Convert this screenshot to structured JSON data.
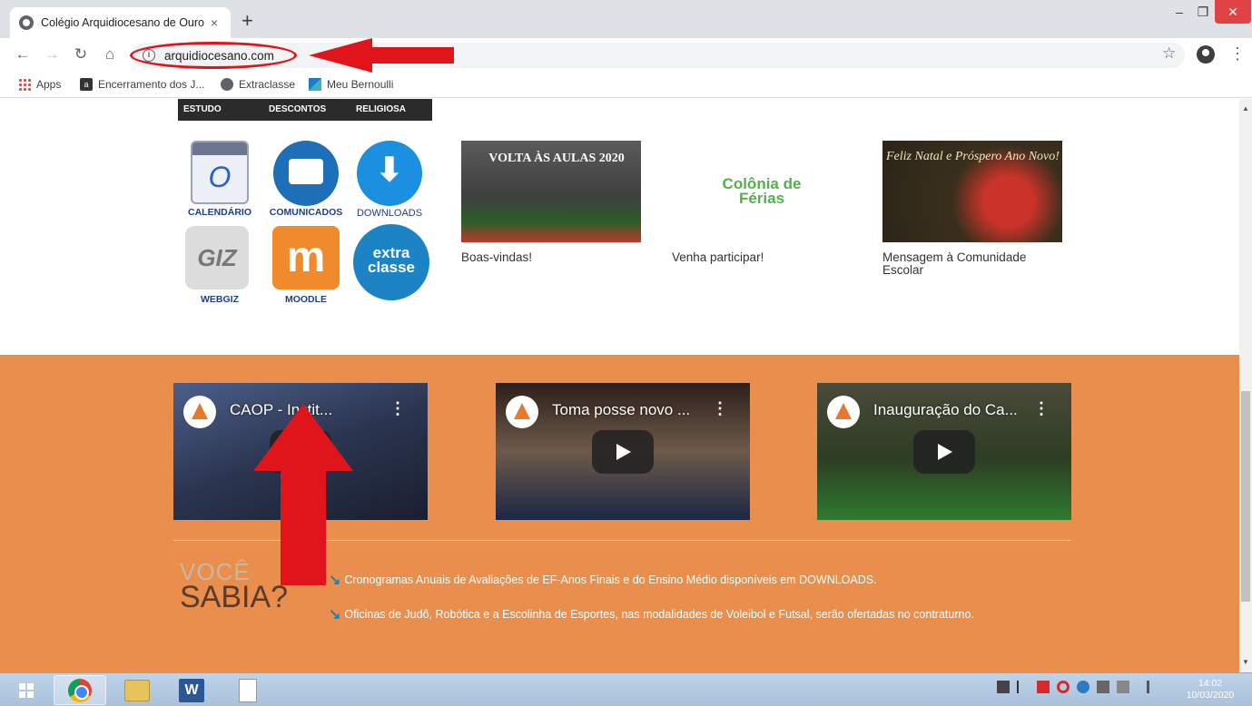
{
  "browser": {
    "tab_title": "Colégio Arquidiocesano de Ouro",
    "tab_close": "×",
    "new_tab": "+",
    "url": "arquidiocesano.com",
    "win_min": "–",
    "win_max": "❐",
    "win_close": "✕"
  },
  "bookmarks": [
    {
      "label": "Apps",
      "icon": "apps-icon"
    },
    {
      "label": "Encerramento dos J...",
      "icon": "a-icon"
    },
    {
      "label": "Extraclasse",
      "icon": "globe-icon"
    },
    {
      "label": "Meu Bernoulli",
      "icon": "bernoulli-icon"
    }
  ],
  "top_strip": [
    "ESTUDO",
    "DESCONTOS",
    "RELIGIOSA"
  ],
  "quick_links": {
    "calendario": "CALENDÁRIO",
    "comunicados": "COMUNICADOS",
    "downloads": "DOWNLOADS",
    "webgiz": "WEBGIZ",
    "moodle": "MOODLE",
    "giz_logo": "GIZ",
    "moodle_logo": "m",
    "extra_logo_1": "extra",
    "extra_logo_2": "classe"
  },
  "news": [
    {
      "caption": "Boas-vindas!",
      "image_text": "VOLTA ÀS AULAS 2020"
    },
    {
      "caption": "Venha participar!",
      "image_text": "Colônia de Férias"
    },
    {
      "caption": "Mensagem à Comunidade Escolar",
      "image_text": "Feliz Natal e Próspero Ano Novo!"
    }
  ],
  "videos": [
    {
      "title": "CAOP - Instit...",
      "menu": "⋮"
    },
    {
      "title": "Toma posse novo ...",
      "menu": "⋮"
    },
    {
      "title": "Inauguração do Ca...",
      "menu": "⋮"
    }
  ],
  "voce_sabia": {
    "line1": "VOCÊ",
    "line2": "SABIA?",
    "tips": [
      "Cronogramas Anuais de Avaliações de EF-Anos Finais e do Ensino Médio disponíveis em DOWNLOADS.",
      "Oficinas de Judô, Robótica e a Escolinha de Esportes, nas modalidades de Voleibol e Futsal, serão ofertadas no contraturno."
    ]
  },
  "taskbar": {
    "time": "14:02",
    "date": "10/03/2020",
    "word_label": "W"
  },
  "colors": {
    "orange_section": "#e98e4c",
    "annotation_red": "#e0151b",
    "link_blue": "#1e3f8a"
  }
}
